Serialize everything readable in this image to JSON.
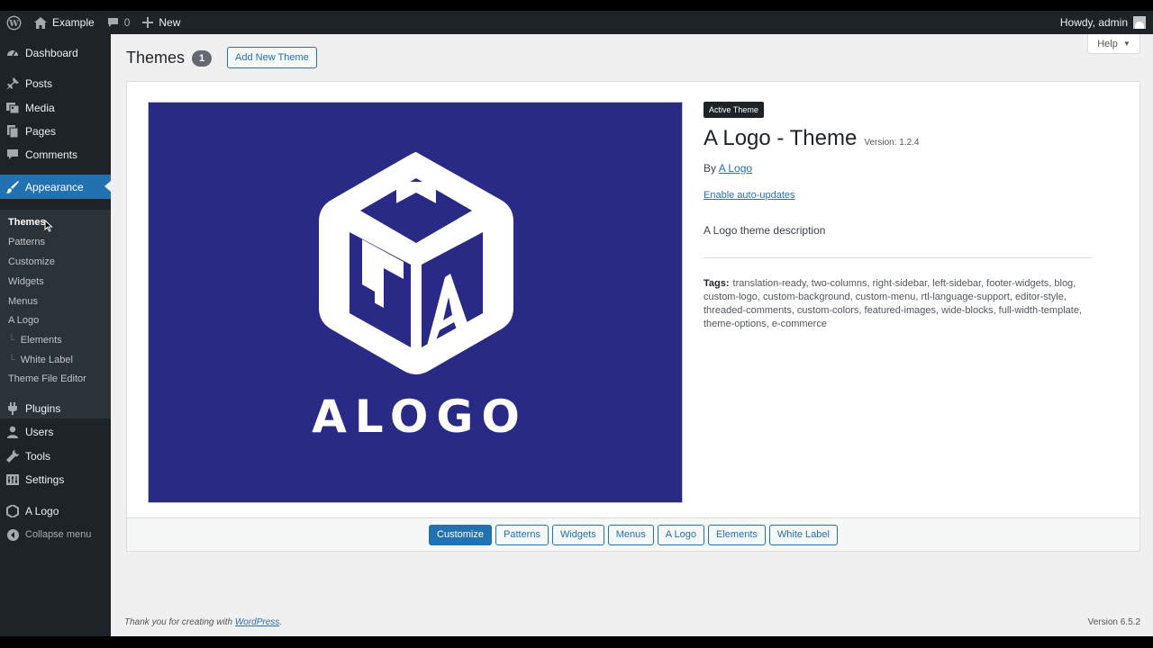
{
  "adminbar": {
    "site_name": "Example",
    "comments_count": "0",
    "new_label": "New",
    "howdy": "Howdy, admin"
  },
  "sidebar": {
    "menu": {
      "dashboard": "Dashboard",
      "posts": "Posts",
      "media": "Media",
      "pages": "Pages",
      "comments": "Comments",
      "appearance": "Appearance",
      "plugins": "Plugins",
      "users": "Users",
      "tools": "Tools",
      "settings": "Settings",
      "alogo": "A Logo",
      "collapse": "Collapse menu"
    },
    "submenu": {
      "themes": "Themes",
      "patterns": "Patterns",
      "customize": "Customize",
      "widgets": "Widgets",
      "menus": "Menus",
      "alogo": "A Logo",
      "elements": "Elements",
      "white_label": "White Label",
      "theme_file_editor": "Theme File Editor"
    }
  },
  "header": {
    "title": "Themes",
    "count": "1",
    "add_new": "Add New Theme",
    "help": "Help"
  },
  "theme": {
    "screenshot_wordmark": "ALOGO",
    "active_label": "Active Theme",
    "name": "A Logo - Theme",
    "version": "Version: 1.2.4",
    "by": "By",
    "author": "A Logo",
    "auto_updates": "Enable auto-updates",
    "description": "A Logo theme description",
    "tags_label": "Tags:",
    "tags": "translation-ready, two-columns, right-sidebar, left-sidebar, footer-widgets, blog, custom-logo, custom-background, custom-menu, rtl-language-support, editor-style, threaded-comments, custom-colors, featured-images, wide-blocks, full-width-template, theme-options, e-commerce",
    "brand_color": "#282a86"
  },
  "actions": {
    "customize": "Customize",
    "patterns": "Patterns",
    "widgets": "Widgets",
    "menus": "Menus",
    "alogo": "A Logo",
    "elements": "Elements",
    "white_label": "White Label"
  },
  "footer": {
    "thanks_prefix": "Thank you for creating with",
    "wordpress": "WordPress",
    "thanks_suffix": ".",
    "version": "Version 6.5.2"
  }
}
